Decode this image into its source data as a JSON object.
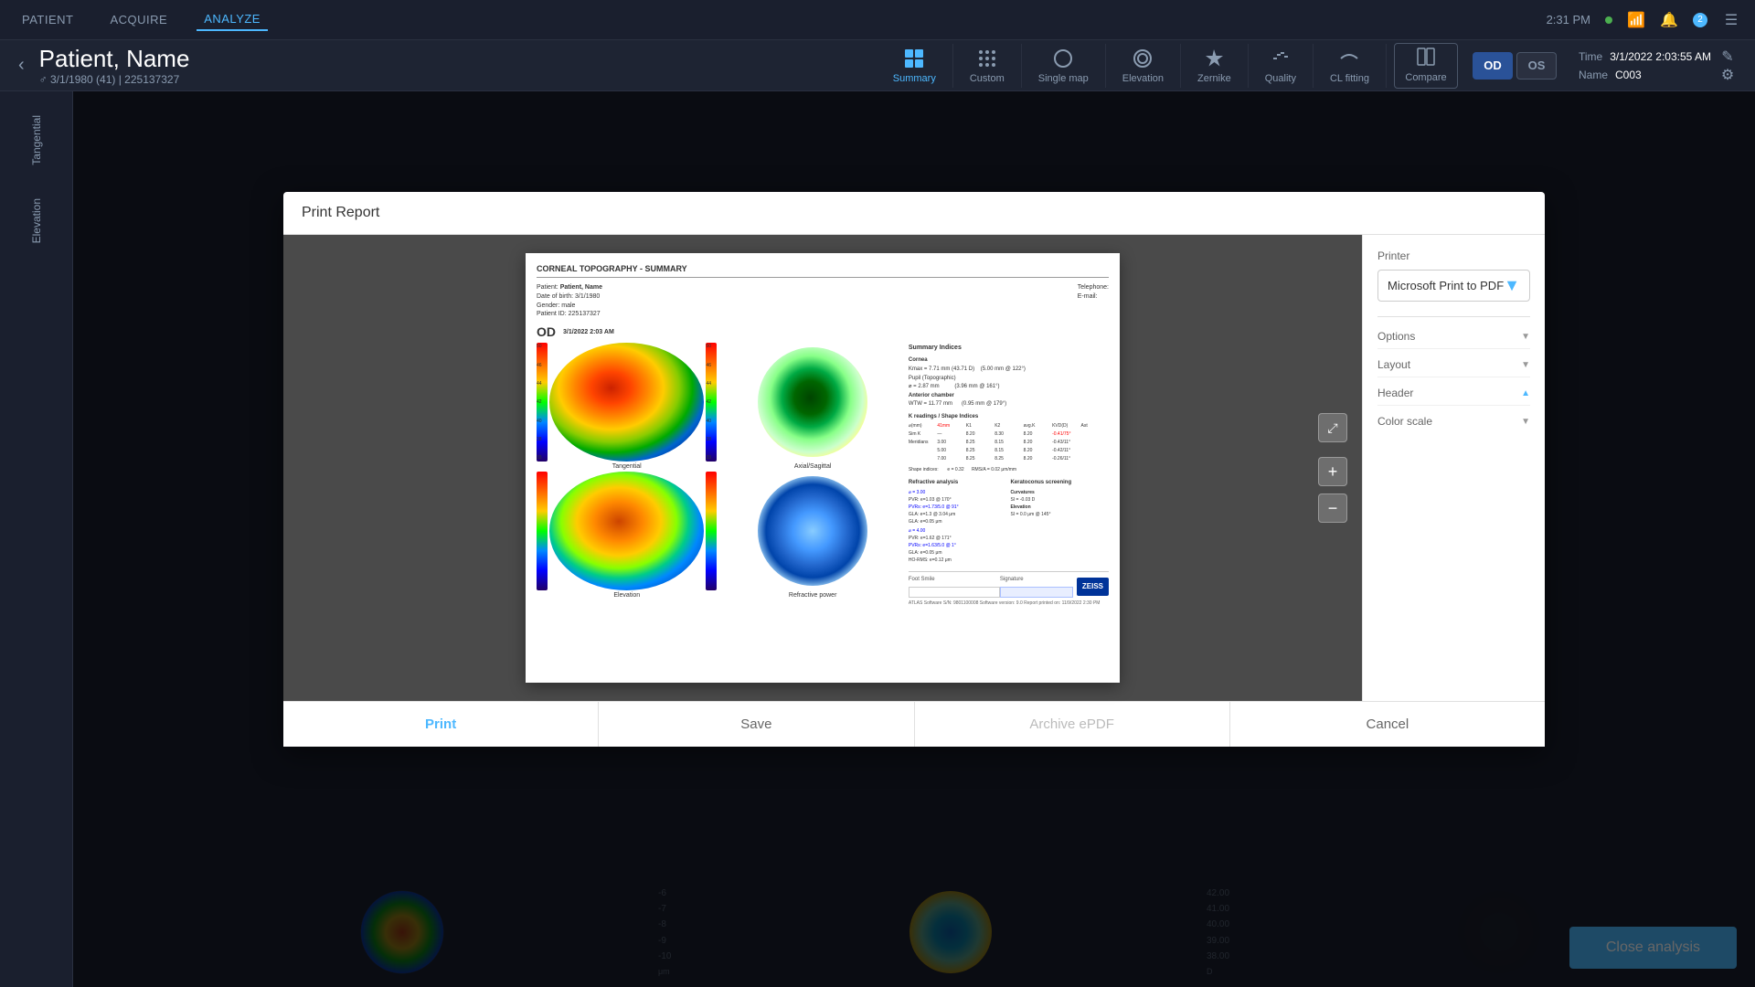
{
  "topNav": {
    "items": [
      {
        "id": "patient",
        "label": "PATIENT",
        "active": false
      },
      {
        "id": "acquire",
        "label": "ACQUIRE",
        "active": false
      },
      {
        "id": "analyze",
        "label": "ANALYZE",
        "active": true
      }
    ],
    "time": "2:31 PM",
    "statusDot": "online",
    "badge": "2"
  },
  "subHeader": {
    "patientName": "Patient, Name",
    "patientInfo": "♂  3/1/1980 (41)  |  225137327",
    "toolbar": {
      "summary": {
        "label": "Summary",
        "active": true
      },
      "custom": {
        "label": "Custom",
        "active": false
      },
      "singleMap": {
        "label": "Single map",
        "active": false
      },
      "elevation": {
        "label": "Elevation",
        "active": false
      },
      "zernike": {
        "label": "Zernike",
        "active": false
      },
      "quality": {
        "label": "Quality",
        "active": false
      },
      "clFitting": {
        "label": "CL fitting",
        "active": false
      }
    },
    "compareBtn": "Compare",
    "odBtn": "OD",
    "osBtn": "OS",
    "time": "3/1/2022 2:03:55 AM",
    "timeLabel": "Time",
    "name": "C003",
    "nameLabel": "Name"
  },
  "sidebar": {
    "items": [
      {
        "id": "tangential",
        "label": "Tangential"
      },
      {
        "id": "elevation",
        "label": "Elevation"
      }
    ]
  },
  "modal": {
    "title": "Print Report",
    "printer": {
      "label": "Printer",
      "value": "Microsoft Print to PDF",
      "dropdownArrow": "▼"
    },
    "report": {
      "header": "CORNEAL TOPOGRAPHY - SUMMARY",
      "patientName": "Patient, Name",
      "dateOfBirth": "3/1/1980",
      "gender": "male",
      "patientId": "225137327",
      "telephone": "Telephone:",
      "email": "E-mail:",
      "odLabel": "OD",
      "dateTime": "3/1/2022 2:03 AM",
      "footstep": "Foot Smile",
      "signature": "Signature",
      "atlasText": "ATLAS Software    S/N: 9801100008   Software version: 9.0    Report printed on: 11/9/2022 2:30 PM",
      "zeissLogo": "ZEISS"
    },
    "sections": {
      "tangential": "Tangential",
      "axialSagittal": "Axial/Sagittal",
      "elevation": "Elevation",
      "refractivePower": "Refractive power"
    },
    "footer": {
      "print": "Print",
      "save": "Save",
      "archiveEPDF": "Archive ePDF",
      "cancel": "Cancel"
    }
  },
  "bottomBar": {
    "scaleValues": [
      "-6",
      "-7",
      "-8",
      "-9",
      "-10"
    ],
    "scaleUnit": "μm",
    "rightScaleValues": [
      "42.00",
      "41.00",
      "40.00",
      "39.00",
      "38.00"
    ],
    "rightUnit": "D"
  },
  "closeAnalysis": {
    "label": "Close analysis"
  },
  "icons": {
    "back": "‹",
    "summary": "⊞",
    "custom": "⋮⋮",
    "singleMap": "○",
    "elevation": "◎",
    "zernike": "✦",
    "quality": "≈",
    "clFitting": "~",
    "compare": "⊡",
    "settings": "⚙",
    "edit": "✎",
    "expand": "⤢",
    "plusZoom": "+",
    "minusZoom": "−",
    "fullscreen": "⤢",
    "chevronDown": "▼",
    "exit": "↑"
  }
}
